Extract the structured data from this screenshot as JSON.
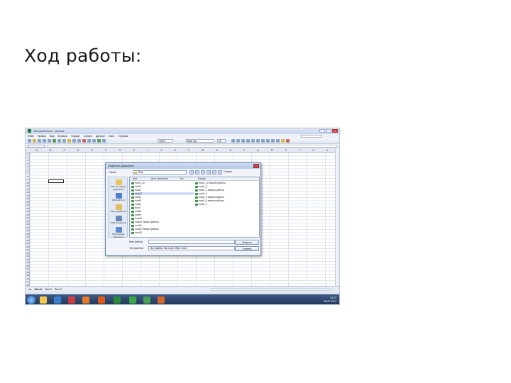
{
  "slide": {
    "title": "Ход работы:"
  },
  "excel": {
    "window_title": "Microsoft Excel - Книга1",
    "menu": [
      "Файл",
      "Правка",
      "Вид",
      "Вставка",
      "Формат",
      "Сервис",
      "Данные",
      "Окно",
      "Справка"
    ],
    "help_placeholder": "Введите вопрос",
    "font_name": "Arial Cyr",
    "font_size": "10",
    "zoom": "100%",
    "columns": [
      "A",
      "B",
      "C",
      "D",
      "E",
      "F",
      "G",
      "H",
      "I",
      "J",
      "K",
      "L",
      "M",
      "N",
      "O",
      "P",
      "Q",
      "R",
      "S",
      "T",
      "U",
      "V"
    ],
    "rows": [
      "1",
      "2",
      "3",
      "4",
      "5",
      "6",
      "7",
      "8",
      "9",
      "10",
      "11",
      "12",
      "13",
      "14",
      "15",
      "16",
      "17",
      "18",
      "19",
      "20",
      "21",
      "22",
      "23",
      "24",
      "25",
      "26",
      "27",
      "28",
      "29",
      "30",
      "31",
      "32",
      "33",
      "34",
      "35",
      "36",
      "37",
      "38",
      "39",
      "40",
      "41",
      "42",
      "43",
      "44"
    ],
    "sheet_tabs": [
      "Лист1",
      "Лист2",
      "Лист3"
    ],
    "tray_time": "13:21",
    "tray_date": "06.02.2013"
  },
  "dialog": {
    "title": "Открытие документа",
    "look_in_label": "Папка:",
    "look_in_value": "Files",
    "service_label": "Сервис",
    "columns": {
      "name": "Имя",
      "modified": "Дата изменения",
      "type": "Тип",
      "size": "Размер"
    },
    "places": [
      "Мои последние документы",
      "Рабочий стол",
      "Мои документы",
      "Мой компьютер",
      "Мое сетевое окружение"
    ],
    "files_left": [
      "mod1_10",
      "mod2",
      "mod3",
      "mod_2",
      "mod4",
      "mod5",
      "mod6",
      "mod7",
      "mod8",
      "mod9",
      "mod10",
      "mod10 начало работы",
      "mod11",
      "mod12 начало работы",
      "mod13"
    ],
    "files_right": [
      "mod1_10 начало работы",
      "mod1_2",
      "mod1_3 начало работы",
      "mod1_4",
      "mod1_5 начало работы",
      "mod1_6 начало работы",
      "mod1_7"
    ],
    "selected_index": 3,
    "filename_label": "Имя файла:",
    "filetype_label": "Тип файлов:",
    "filetype_value": "Все файлы Microsoft Office Excel",
    "open_button": "Открыть",
    "cancel_button": "Отмена"
  }
}
